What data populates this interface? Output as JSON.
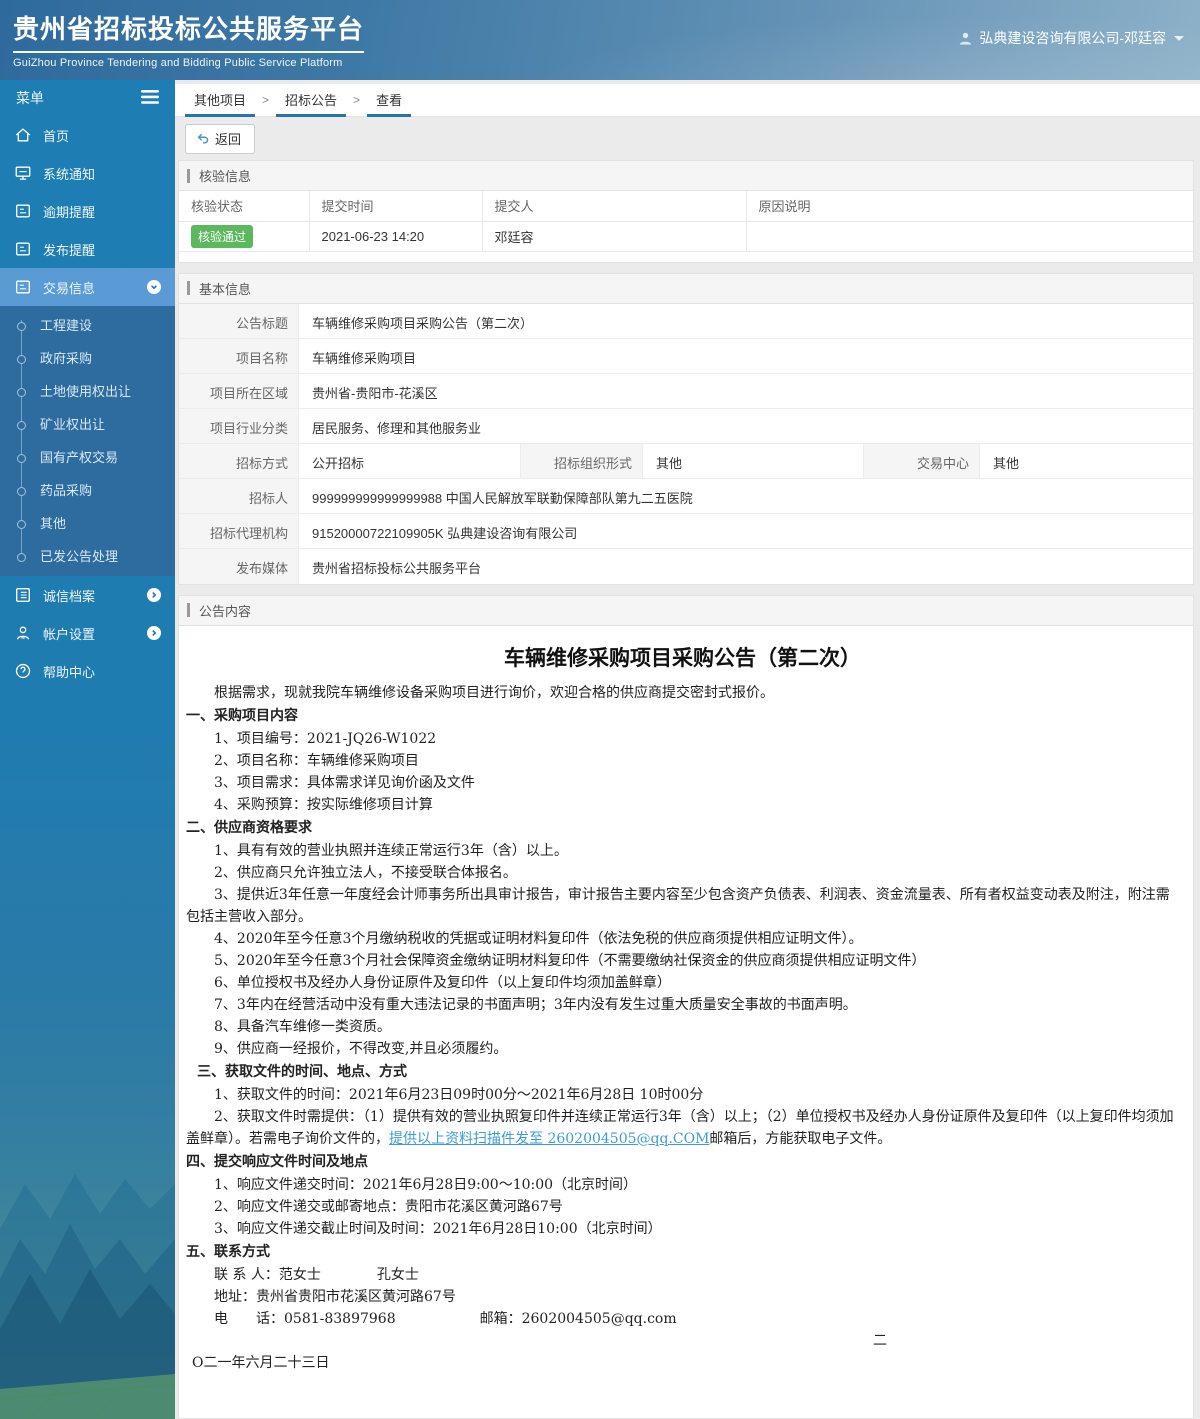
{
  "header": {
    "title": "贵州省招标投标公共服务平台",
    "subtitle": "GuiZhou Province Tendering and Bidding Public Service Platform",
    "user": "弘典建设咨询有限公司-邓廷容"
  },
  "sidebar": {
    "menu_label": "菜单",
    "items": [
      {
        "label": "首页"
      },
      {
        "label": "系统通知"
      },
      {
        "label": "逾期提醒"
      },
      {
        "label": "发布提醒"
      },
      {
        "label": "交易信息"
      }
    ],
    "submenu": [
      "工程建设",
      "政府采购",
      "土地使用权出让",
      "矿业权出让",
      "国有产权交易",
      "药品采购",
      "其他",
      "已发公告处理"
    ],
    "items_bottom": [
      {
        "label": "诚信档案"
      },
      {
        "label": "帐户设置"
      },
      {
        "label": "帮助中心"
      }
    ]
  },
  "breadcrumb": {
    "items": [
      "其他项目",
      "招标公告",
      "查看"
    ],
    "separator": ">"
  },
  "toolbar": {
    "back_label": "返回"
  },
  "verify": {
    "title": "核验信息",
    "headers": [
      "核验状态",
      "提交时间",
      "提交人",
      "原因说明"
    ],
    "row": {
      "status": "核验通过",
      "time": "2021-06-23 14:20",
      "person": "邓廷容",
      "reason": ""
    }
  },
  "basic": {
    "title": "基本信息",
    "rows": [
      {
        "label": "公告标题",
        "value": "车辆维修采购项目采购公告（第二次）"
      },
      {
        "label": "项目名称",
        "value": "车辆维修采购项目"
      },
      {
        "label": "项目所在区域",
        "value": "贵州省-贵阳市-花溪区"
      },
      {
        "label": "项目行业分类",
        "value": "居民服务、修理和其他服务业"
      }
    ],
    "triple": [
      {
        "label": "招标方式",
        "value": "公开招标"
      },
      {
        "label": "招标组织形式",
        "value": "其他"
      },
      {
        "label": "交易中心",
        "value": "其他"
      }
    ],
    "rows2": [
      {
        "label": "招标人",
        "value": "999999999999999988 中国人民解放军联勤保障部队第九二五医院"
      },
      {
        "label": "招标代理机构",
        "value": "91520000722109905K 弘典建设咨询有限公司"
      },
      {
        "label": "发布媒体",
        "value": "贵州省招标投标公共服务平台"
      }
    ]
  },
  "notice": {
    "title": "公告内容",
    "doc_title": "车辆维修采购项目采购公告（第二次）",
    "intro": "根据需求，现就我院车辆维修设备采购项目进行询价，欢迎合格的供应商提交密封式报价。",
    "sec1_heading": "一、采购项目内容",
    "sec1_items": [
      "1、项目编号：2021-JQ26-W1022",
      "2、项目名称：车辆维修采购项目",
      "3、项目需求：具体需求详见询价函及文件",
      "4、采购预算：按实际维修项目计算"
    ],
    "sec2_heading": "二、供应商资格要求",
    "sec2_items": [
      "1、具有有效的营业执照并连续正常运行3年（含）以上。",
      "2、供应商只允许独立法人，不接受联合体报名。",
      "3、提供近3年任意一年度经会计师事务所出具审计报告，审计报告主要内容至少包含资产负债表、利润表、资金流量表、所有者权益变动表及附注，附注需包括主营收入部分。",
      "4、2020年至今任意3个月缴纳税收的凭据或证明材料复印件（依法免税的供应商须提供相应证明文件）。",
      "5、2020年至今任意3个月社会保障资金缴纳证明材料复印件（不需要缴纳社保资金的供应商须提供相应证明文件）",
      "6、单位授权书及经办人身份证原件及复印件（以上复印件均须加盖鲜章）",
      "7、3年内在经营活动中没有重大违法记录的书面声明；3年内没有发生过重大质量安全事故的书面声明。",
      "8、具备汽车维修一类资质。",
      "9、供应商一经报价，不得改变,并且必须履约。"
    ],
    "sec3_heading": "三、获取文件的时间、地点、方式",
    "sec3_item1": "1、获取文件的时间：2021年6月23日09时00分～2021年6月28日 10时00分",
    "sec3_item2_pre": "2、获取文件时需提供：（1）提供有效的营业执照复印件并连续正常运行3年（含）以上；（2）单位授权书及经办人身份证原件及复印件（以上复印件均须加盖鲜章）。若需电子询价文件的，",
    "sec3_item2_link": "提供以上资料扫描件发至 2602004505@qq.COM",
    "sec3_item2_post": "邮箱后，方能获取电子文件。",
    "sec4_heading": "四、提交响应文件时间及地点",
    "sec4_items": [
      "1、响应文件递交时间：2021年6月28日9:00～10:00（北京时间）",
      "2、响应文件递交或邮寄地点：贵阳市花溪区黄河路67号",
      "3、响应文件递交截止时间及时间：2021年6月28日10:00（北京时间）"
    ],
    "sec5_heading": "五、联系方式",
    "contact_person": "联 系 人：范女士　　　　孔女士",
    "contact_address": "地址：贵州省贵阳市花溪区黄河路67号",
    "contact_phone": "电　　话：0581-83897968　　　　　　邮箱：2602004505@qq.com",
    "date_line1": "二",
    "date_line2": "O二一年六月二十三日"
  },
  "icons": {
    "hamburger-icon": "≡",
    "home-icon": "house",
    "monitor-icon": "screen",
    "doc-icon": "document",
    "list-icon": "list",
    "user-icon": "person",
    "question-icon": "?",
    "chevron-down-circle-icon": "▾",
    "chevron-right-circle-icon": "▸",
    "person-icon": "user silhouette",
    "caret-down-icon": "▾",
    "back-icon": "↩"
  },
  "colors": {
    "sidebar_blue": "#1e7db2",
    "sidebar_active": "#5b9bd5",
    "submenu_blue": "#2e6b9e",
    "breadcrumb_accent": "#2873a8",
    "status_green": "#5cb85c",
    "link_blue": "#3d9bd8"
  }
}
